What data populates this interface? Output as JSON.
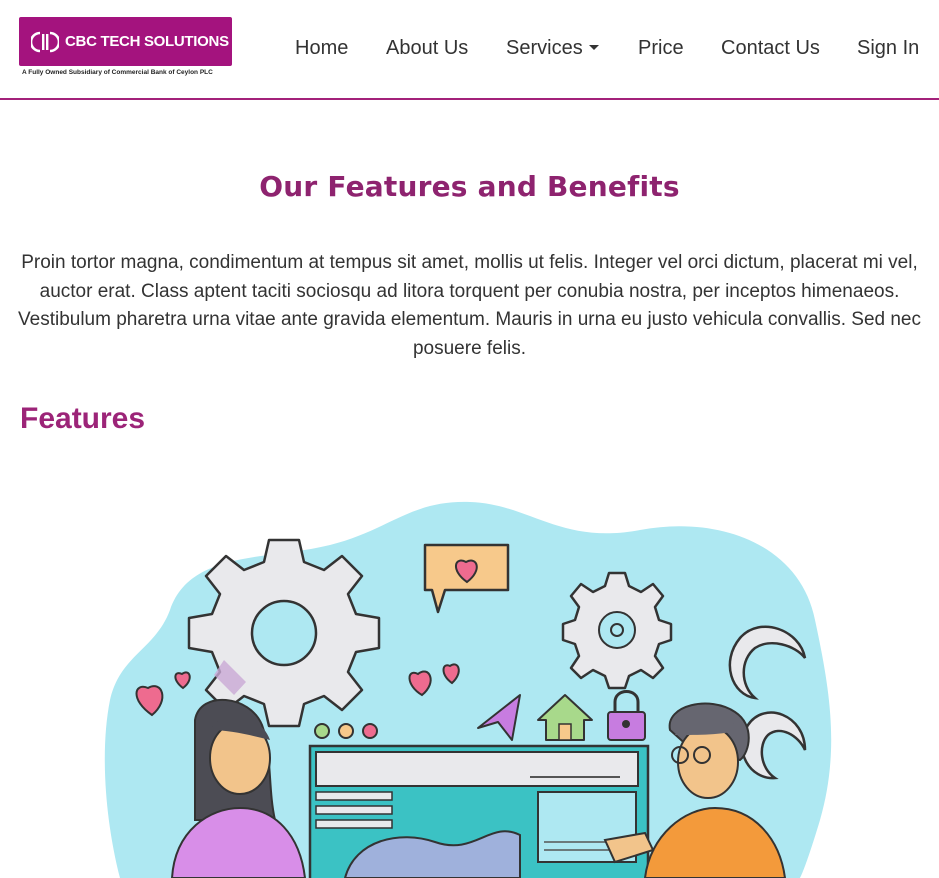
{
  "header": {
    "logo_text": "CBC TECH SOLUTIONS",
    "logo_tagline": "A Fully Owned Subsidiary of Commercial Bank of Ceylon PLC",
    "brand_color": "#a4137e"
  },
  "nav": {
    "home": "Home",
    "about": "About Us",
    "services": "Services",
    "price": "Price",
    "contact": "Contact Us",
    "signin": "Sign In"
  },
  "main": {
    "title": "Our Features and Benefits",
    "intro": "Proin tortor magna, condimentum at tempus sit amet, mollis ut felis. Integer vel orci dictum, placerat mi vel, auctor erat. Class aptent taciti sociosqu ad litora torquent per conubia nostra, per inceptos himenaeos. Vestibulum pharetra urna vitae ante gravida elementum. Mauris in urna eu justo vehicula convallis. Sed nec posuere felis.",
    "features_heading": "Features",
    "accent_color": "#9c2478"
  }
}
